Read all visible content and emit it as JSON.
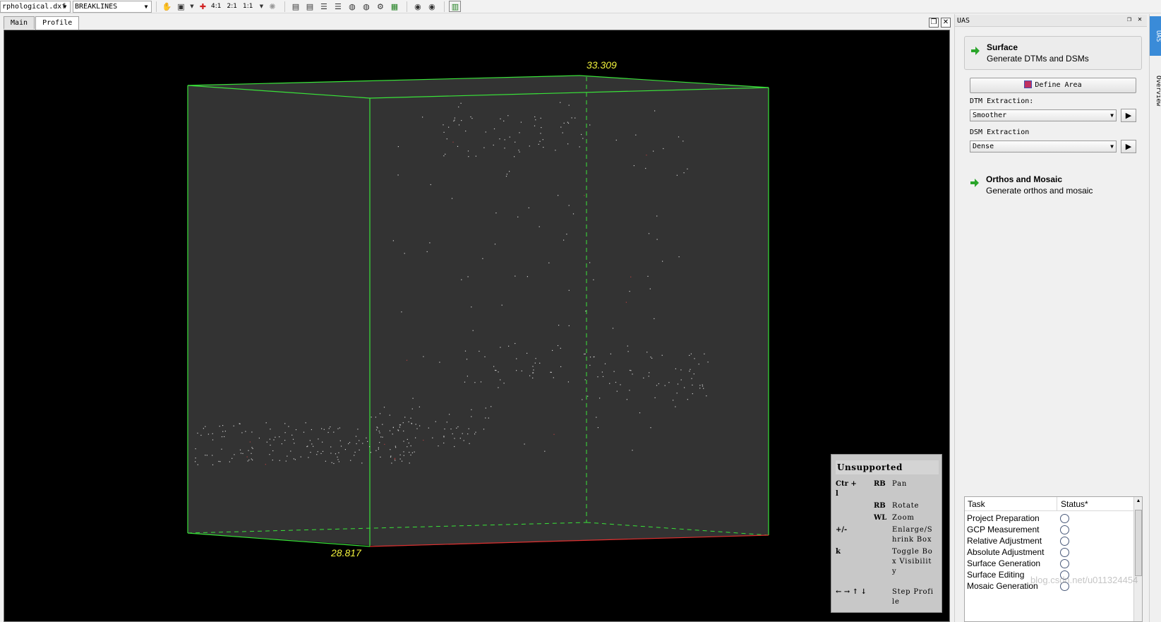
{
  "toolbar": {
    "file_combo": "rphological.dxf",
    "layer_combo": "BREAKLINES",
    "zoom_4_1": "4:1",
    "zoom_2_1": "2:1",
    "zoom_1_1": "1:1"
  },
  "tabs": [
    {
      "label": "Main",
      "active": false
    },
    {
      "label": "Profile",
      "active": true
    }
  ],
  "viewport": {
    "top_label": "33.309",
    "bottom_label": "28.817",
    "box_color": "#39e339",
    "label_color": "#f2f23c"
  },
  "help": {
    "title": "Unsupported",
    "rows": [
      {
        "key": "Ctr + l",
        "mouse": "RB",
        "desc": "Pan"
      },
      {
        "key": "",
        "mouse": "RB",
        "desc": "Rotate"
      },
      {
        "key": "",
        "mouse": "WL",
        "desc": "Zoom"
      },
      {
        "key": "+/-",
        "mouse": "",
        "desc": "Enlarge/Shrink Box"
      },
      {
        "key": "k",
        "mouse": "",
        "desc": "Toggle Box Visibility"
      },
      {
        "key": "← → ↑ ↓",
        "mouse": "",
        "desc": "Step Profile"
      }
    ]
  },
  "panel": {
    "title": "UAS",
    "surface": {
      "title": "Surface",
      "subtitle": "Generate DTMs and DSMs"
    },
    "define_area": "Define Area",
    "dtm_label": "DTM Extraction:",
    "dtm_value": "Smoother",
    "dsm_label": "DSM Extraction",
    "dsm_value": "Dense",
    "orthos": {
      "title": "Orthos and Mosaic",
      "subtitle": "Generate orthos and mosaic"
    }
  },
  "tasks": {
    "col_task": "Task",
    "col_status": "Status*",
    "rows": [
      "Project Preparation",
      "GCP Measurement",
      "Relative Adjustment",
      "Absolute Adjustment",
      "Surface Generation",
      "Surface Editing",
      "Mosaic Generation"
    ],
    "watermark": "blog.csdn.net/u011324454"
  },
  "side_tabs": {
    "uas": "UAS",
    "overview": "Overview"
  }
}
